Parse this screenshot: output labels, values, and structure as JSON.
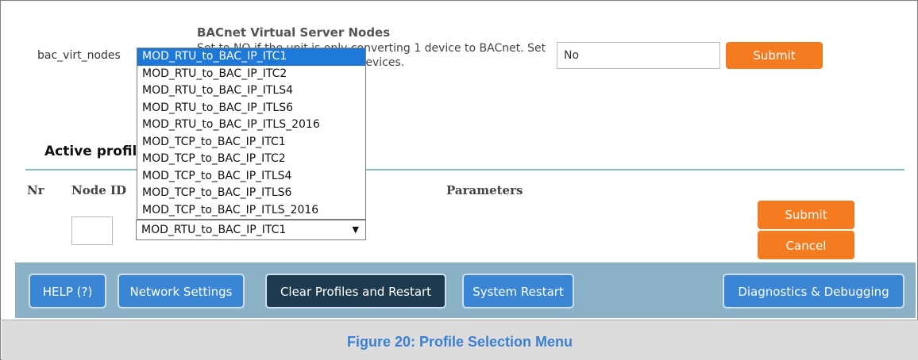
{
  "config": {
    "name": "bac_virt_nodes",
    "title": "BACnet Virtual Server Nodes",
    "description": "Set to NO if the unit is only converting 1 device to BACnet. Set to YES if converting multiple devices.",
    "value": "No",
    "submit_label": "Submit"
  },
  "active_profiles": {
    "title": "Active profiles",
    "headers": {
      "nr": "Nr",
      "node_id": "Node ID",
      "parameters": "Parameters"
    }
  },
  "dropdown": {
    "selected": "MOD_RTU_to_BAC_IP_ITC1",
    "options": [
      "MOD_RTU_to_BAC_IP_ITC1",
      "MOD_RTU_to_BAC_IP_ITC2",
      "MOD_RTU_to_BAC_IP_ITLS4",
      "MOD_RTU_to_BAC_IP_ITLS6",
      "MOD_RTU_to_BAC_IP_ITLS_2016",
      "MOD_TCP_to_BAC_IP_ITC1",
      "MOD_TCP_to_BAC_IP_ITC2",
      "MOD_TCP_to_BAC_IP_ITLS4",
      "MOD_TCP_to_BAC_IP_ITLS6",
      "MOD_TCP_to_BAC_IP_ITLS_2016"
    ]
  },
  "row_actions": {
    "submit_label": "Submit",
    "cancel_label": "Cancel"
  },
  "toolbar": {
    "help": "HELP (?)",
    "network": "Network Settings",
    "clear": "Clear Profiles and Restart",
    "restart": "System Restart",
    "diagnostics": "Diagnostics & Debugging"
  },
  "caption": "Figure 20: Profile Selection Menu",
  "colors": {
    "accent": "#f47b20",
    "toolbar": "#8bb1c6",
    "button": "#3a86d4",
    "selected": "#1e78d7",
    "caption": "#3b7fd0"
  }
}
